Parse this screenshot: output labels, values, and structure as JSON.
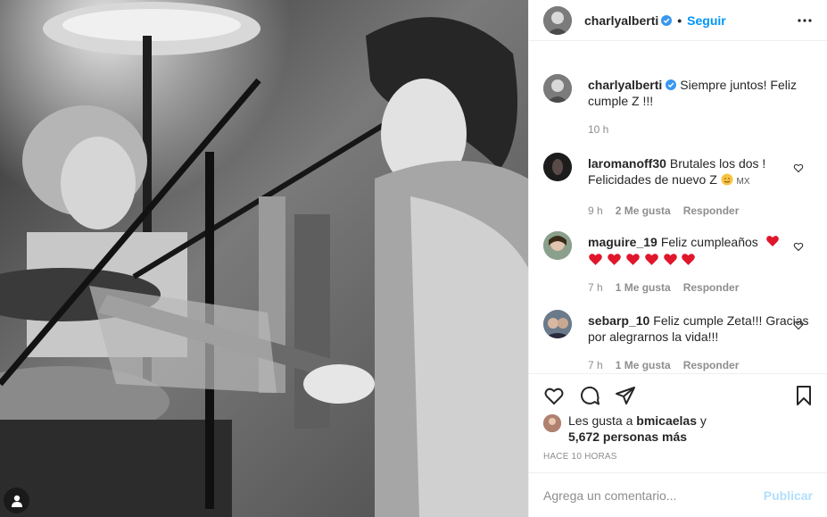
{
  "post": {
    "author": "charlyalberti",
    "follow_label": "Seguir",
    "dot": "•"
  },
  "caption": {
    "user": "charlyalberti",
    "text": "Siempre juntos! Feliz cumple Z !!!",
    "time": "10 h"
  },
  "comments": [
    {
      "user": "laromanoff30",
      "text": "Brutales los dos ! Felicidades de nuevo Z",
      "suffix": "MX",
      "time": "9 h",
      "likes": "2 Me gusta",
      "reply": "Responder"
    },
    {
      "user": "maguire_19",
      "text": "Feliz cumpleaños",
      "time": "7 h",
      "likes": "1 Me gusta",
      "reply": "Responder"
    },
    {
      "user": "sebarp_10",
      "text": "Feliz cumple Zeta!!! Gracias por alegrarnos la vida!!!",
      "time": "7 h",
      "likes": "1 Me gusta",
      "reply": "Responder"
    }
  ],
  "likes": {
    "prefix": "Les gusta a",
    "user": "bmicaelas",
    "conj": "y",
    "others": "5,672 personas más"
  },
  "posted": "HACE 10 HORAS",
  "add_comment": {
    "placeholder": "Agrega un comentario...",
    "publish": "Publicar"
  },
  "colors": {
    "accent": "#0095f6",
    "verified": "#3897f0",
    "heart": "#ed4956",
    "publish_disabled": "#b2dffc"
  },
  "icons": [
    "verified-icon",
    "more-icon",
    "heart-icon",
    "comment-icon",
    "share-icon",
    "bookmark-icon",
    "user-tag-icon"
  ]
}
